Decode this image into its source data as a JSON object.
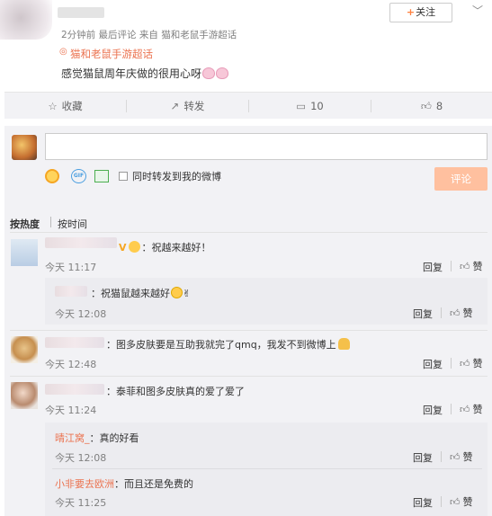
{
  "post": {
    "meta": "2分钟前 最后评论 来自 猫和老鼠手游超话",
    "topic_link": "猫和老鼠手游超话",
    "text": "感觉猫鼠周年庆做的很用心呀",
    "follow_label": "关注"
  },
  "actions": {
    "favorite": "收藏",
    "repost": "转发",
    "comment_count": "10",
    "like_count": "8"
  },
  "composer": {
    "input_placeholder": "",
    "repost_checkbox_label": "同时转发到我的微博",
    "submit_label": "评论"
  },
  "sort": {
    "by_heat": "按热度",
    "by_time": "按时间"
  },
  "labels": {
    "reply": "回复",
    "like": "赞"
  },
  "comments": [
    {
      "text": "：祝越来越好！",
      "time": "今天 11:17",
      "replies": [
        {
          "text": "：祝猫鼠越来越好",
          "time": "今天 12:08"
        }
      ]
    },
    {
      "text": "：图多皮肤要是互助我就完了qmq，我发不到微博上",
      "time": "今天 12:48",
      "replies": []
    },
    {
      "text": "：泰菲和图多皮肤真的爱了爱了",
      "time": "今天 11:24",
      "replies": [
        {
          "user": "晴江窝_",
          "text": "：真的好看",
          "time": "今天 12:08"
        },
        {
          "user": "小非要去欧洲",
          "text": "：而且还是免费的",
          "time": "今天 11:25"
        }
      ]
    }
  ],
  "colors": {
    "accent": "#eb7350",
    "follow_plus": "#ff8140",
    "submit_disabled": "#ffc09f",
    "panel_bg": "#f2f2f5"
  }
}
